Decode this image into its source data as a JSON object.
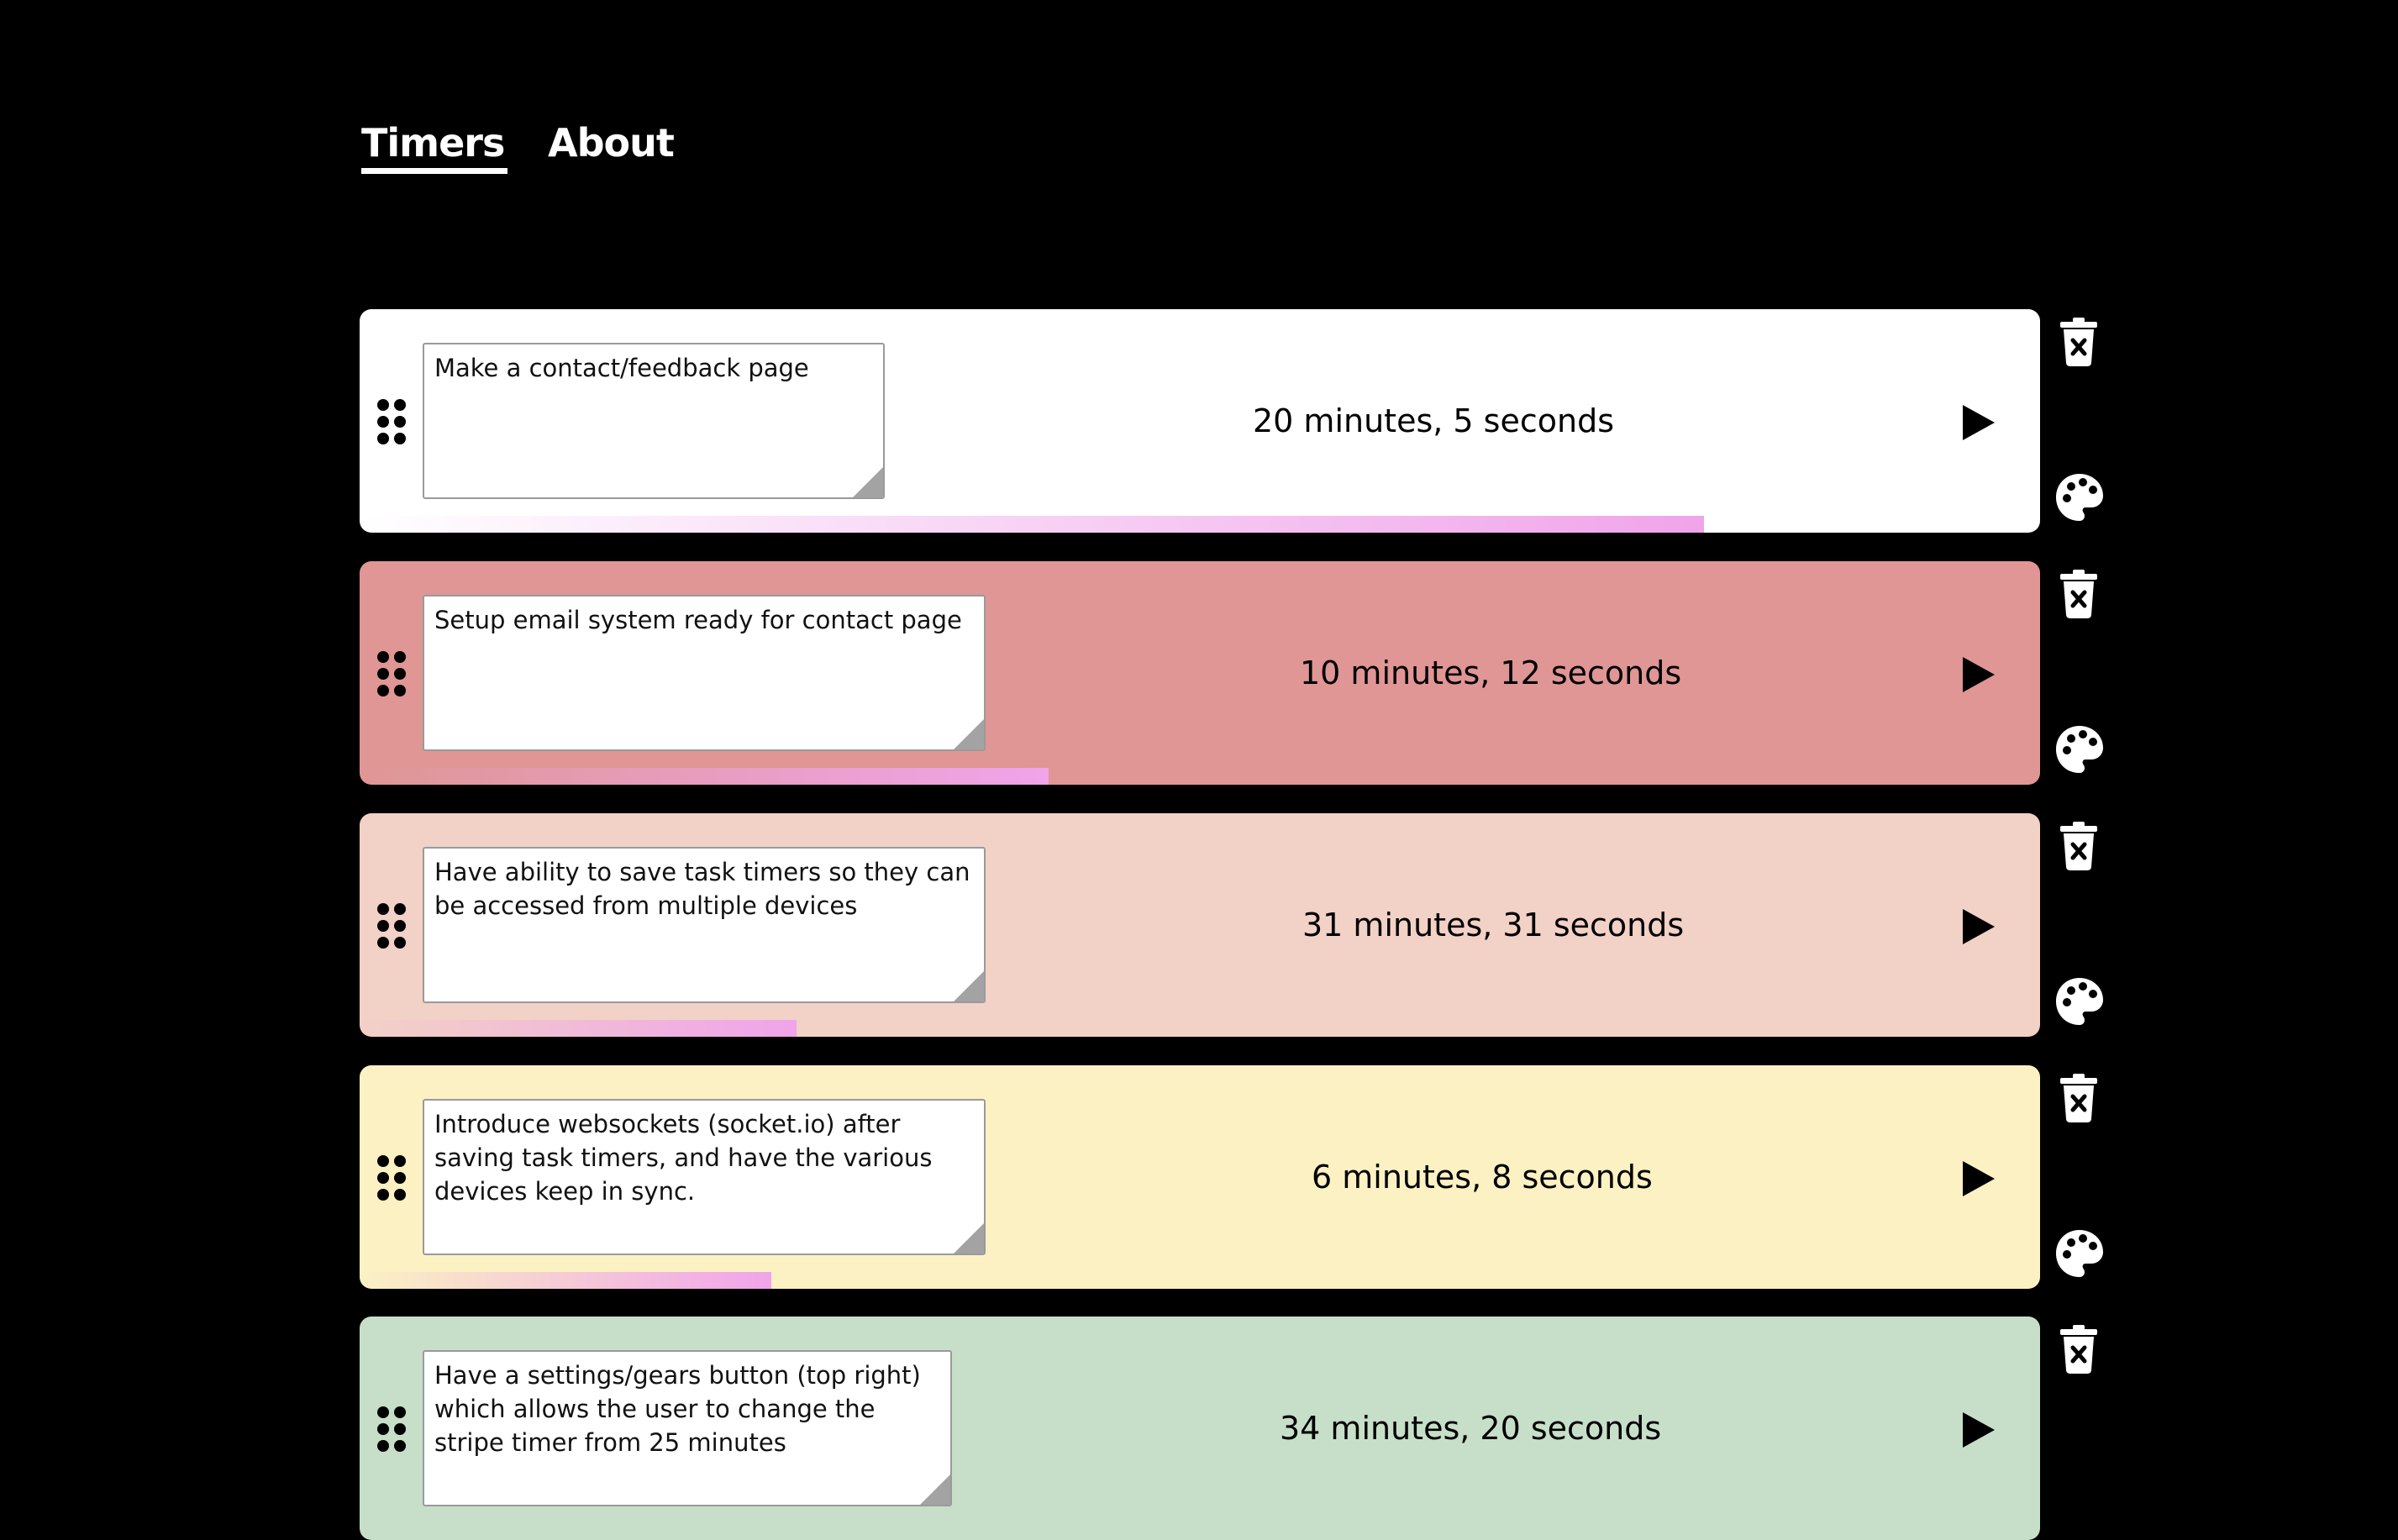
{
  "nav": {
    "timers_label": "Timers",
    "about_label": "About",
    "active": "Timers"
  },
  "timers": [
    {
      "note": "Make a contact/feedback page",
      "time": "20 minutes, 5 seconds",
      "color": "#ffffff",
      "progress": 0.8
    },
    {
      "note": "Setup email system ready for contact page",
      "time": "10 minutes, 12 seconds",
      "color": "#df9694",
      "progress": 0.41
    },
    {
      "note": "Have ability to save task timers so they can be accessed from multiple devices",
      "time": "31 minutes, 31 seconds",
      "color": "#f2d1c6",
      "progress": 0.26
    },
    {
      "note": "Introduce websockets (socket.io) after saving task timers, and have the various devices keep in sync.",
      "time": "6 minutes, 8 seconds",
      "color": "#fbf1c3",
      "progress": 0.245
    },
    {
      "note": "Have a settings/gears button (top right) which allows the user to change the stripe timer from 25 minutes",
      "time": "34 minutes, 20 seconds",
      "color": "#c7dfc8",
      "progress": 0
    }
  ],
  "progress_gradient": {
    "start": "rgba(240,164,234,0)",
    "end": "#f0a4ea"
  },
  "icons": {
    "drag": "drag-handle-icon",
    "play": "play-icon",
    "delete": "trash-icon",
    "color": "palette-icon"
  }
}
